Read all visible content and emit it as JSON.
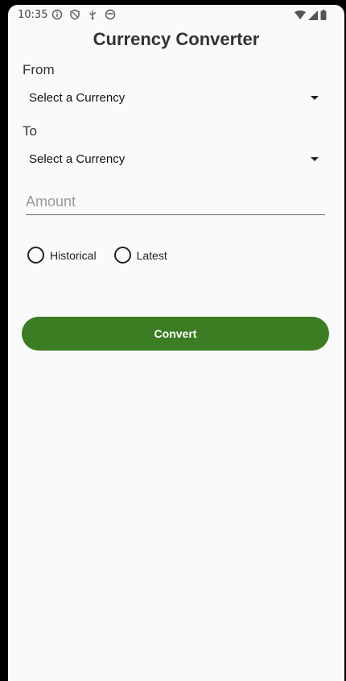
{
  "status_bar": {
    "time": "10:35",
    "icons_left": [
      "info-icon",
      "shield-icon",
      "usb-icon",
      "sync-icon"
    ],
    "icons_right": [
      "wifi-icon",
      "signal-icon",
      "battery-icon"
    ]
  },
  "app": {
    "title": "Currency Converter"
  },
  "from": {
    "label": "From",
    "selected": "Select a Currency"
  },
  "to": {
    "label": "To",
    "selected": "Select a Currency"
  },
  "amount": {
    "value": "",
    "placeholder": "Amount"
  },
  "rate_type": {
    "options": [
      {
        "label": "Historical",
        "selected": false
      },
      {
        "label": "Latest",
        "selected": false
      }
    ]
  },
  "actions": {
    "convert_label": "Convert"
  },
  "colors": {
    "accent": "#3a7d22",
    "background": "#fafafa"
  }
}
